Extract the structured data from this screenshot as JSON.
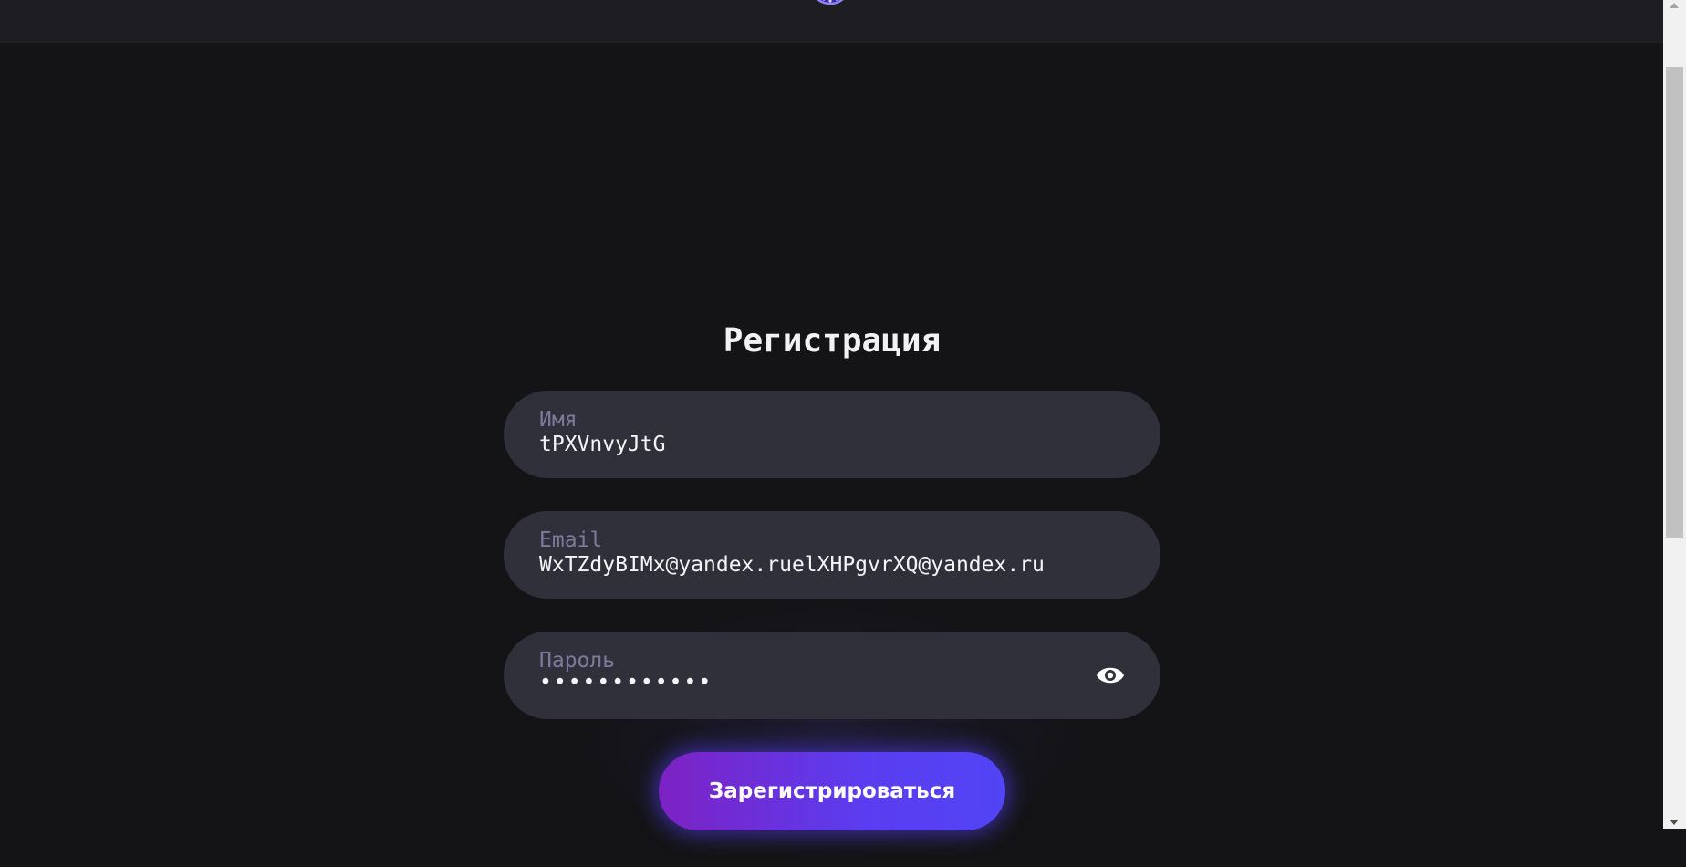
{
  "header": {
    "logo_icon": "logo-circle-icon"
  },
  "form": {
    "title": "Регистрация",
    "name": {
      "label": "Имя",
      "value": "tPXVnvyJtG"
    },
    "email": {
      "label": "Email",
      "value": "WxTZdyBIMx@yandex.ruelXHPgvrXQ@yandex.ru"
    },
    "password": {
      "label": "Пароль",
      "value": "••••••••••••",
      "toggle_icon": "eye-icon"
    },
    "submit_label": "Зарегистрироваться"
  },
  "colors": {
    "background": "#141416",
    "header": "#1d1d22",
    "field": "#30303a",
    "label": "#7c7a9d",
    "button_start": "#7d22c4",
    "button_end": "#5145f5"
  }
}
